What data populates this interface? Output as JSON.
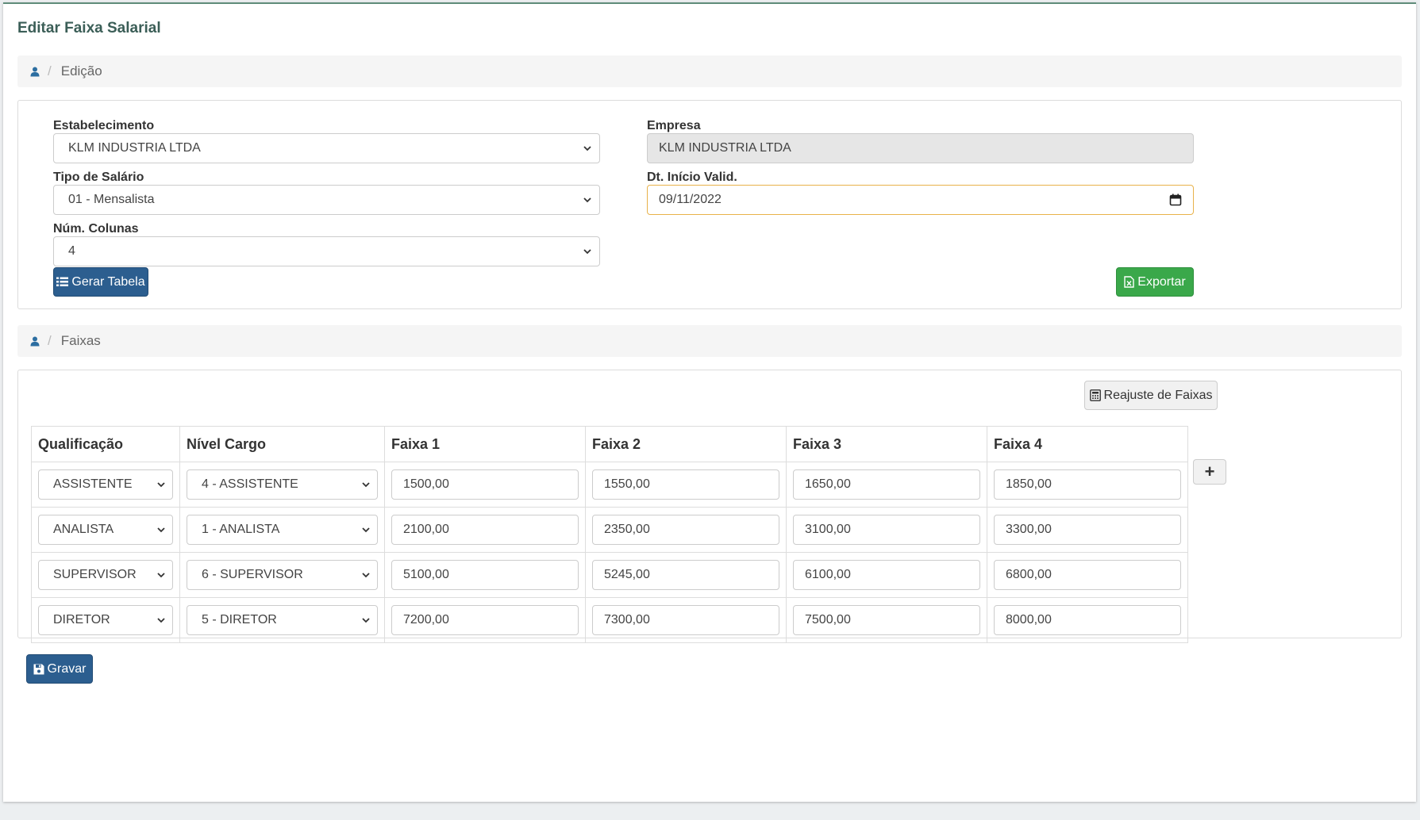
{
  "page": {
    "title": "Editar Faixa Salarial"
  },
  "breadcrumb_edit": {
    "label": "Edição"
  },
  "form": {
    "estabelecimento": {
      "label": "Estabelecimento",
      "value": "KLM INDUSTRIA LTDA"
    },
    "tipo_salario": {
      "label": "Tipo de Salário",
      "value": "01 - Mensalista"
    },
    "num_colunas": {
      "label": "Núm. Colunas",
      "value": "4"
    },
    "empresa": {
      "label": "Empresa",
      "value": "KLM INDUSTRIA LTDA"
    },
    "dt_inicio": {
      "label": "Dt. Início Valid.",
      "value": "09/11/2022"
    },
    "gerar_tabela_label": "Gerar Tabela",
    "exportar_label": "Exportar"
  },
  "breadcrumb_faixas": {
    "label": "Faixas"
  },
  "faixas": {
    "reajuste_label": "Reajuste de Faixas",
    "headers": [
      "Qualificação",
      "Nível Cargo",
      "Faixa 1",
      "Faixa 2",
      "Faixa 3",
      "Faixa 4"
    ],
    "rows": [
      {
        "qualificacao": "ASSISTENTE",
        "nivel": "4 - ASSISTENTE",
        "faixas": [
          "1500,00",
          "1550,00",
          "1650,00",
          "1850,00"
        ]
      },
      {
        "qualificacao": "ANALISTA",
        "nivel": "1 - ANALISTA",
        "faixas": [
          "2100,00",
          "2350,00",
          "3100,00",
          "3300,00"
        ]
      },
      {
        "qualificacao": "SUPERVISOR",
        "nivel": "6 - SUPERVISOR",
        "faixas": [
          "5100,00",
          "5245,00",
          "6100,00",
          "6800,00"
        ]
      },
      {
        "qualificacao": "DIRETOR",
        "nivel": "5 - DIRETOR",
        "faixas": [
          "7200,00",
          "7300,00",
          "7500,00",
          "8000,00"
        ]
      }
    ],
    "add_row_label": "+"
  },
  "gravar_label": "Gravar",
  "colors": {
    "primary": "#2c5e8f",
    "success": "#3aa84a",
    "title": "#3b5e57",
    "focus_border": "#e8b24a"
  }
}
